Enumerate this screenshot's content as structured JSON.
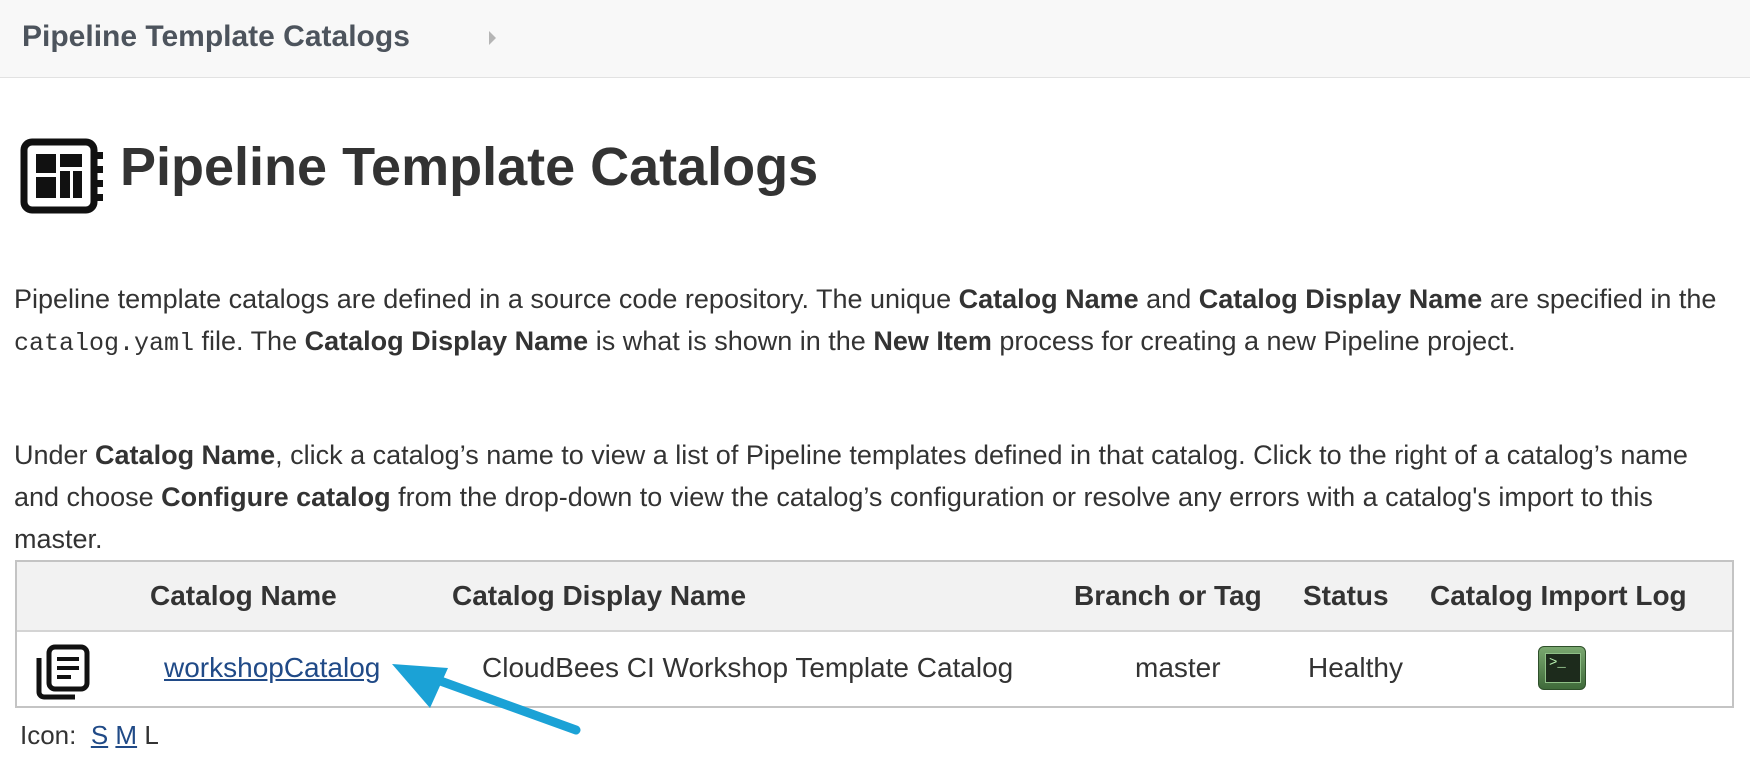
{
  "breadcrumb": {
    "item": "Pipeline Template Catalogs"
  },
  "header": {
    "title": "Pipeline Template Catalogs",
    "icon": "catalog-grid-icon"
  },
  "description": {
    "p1": [
      {
        "text": "Pipeline template catalogs are defined in a source code repository. The unique ",
        "style": "normal"
      },
      {
        "text": "Catalog Name",
        "style": "bold"
      },
      {
        "text": " and ",
        "style": "normal"
      },
      {
        "text": "Catalog Display Name",
        "style": "bold"
      },
      {
        "text": " are specified in the ",
        "style": "normal"
      },
      {
        "text": "catalog.yaml",
        "style": "code"
      },
      {
        "text": " file. The ",
        "style": "normal"
      },
      {
        "text": "Catalog Display Name",
        "style": "bold"
      },
      {
        "text": " is what is shown in the ",
        "style": "normal"
      },
      {
        "text": "New Item",
        "style": "bold"
      },
      {
        "text": " process for creating a new Pipeline project.",
        "style": "normal"
      }
    ],
    "p2": [
      {
        "text": "Under ",
        "style": "normal"
      },
      {
        "text": "Catalog Name",
        "style": "bold"
      },
      {
        "text": ", click a catalog’s name to view a list of Pipeline templates defined in that catalog. Click to the right of a catalog’s name and choose ",
        "style": "normal"
      },
      {
        "text": "Configure catalog",
        "style": "bold"
      },
      {
        "text": " from the drop-down to view the catalog’s configuration or resolve any errors with a catalog's import to this master.",
        "style": "normal"
      }
    ]
  },
  "table": {
    "headers": {
      "name": "Catalog Name",
      "display": "Catalog Display Name",
      "branch": "Branch or Tag",
      "status": "Status",
      "log": "Catalog Import Log"
    },
    "row": {
      "icon": "catalog-document-icon",
      "name": "workshopCatalog",
      "display": "CloudBees CI Workshop Template Catalog",
      "branch": "master",
      "status": "Healthy",
      "log_icon": "terminal-icon"
    }
  },
  "icon_size": {
    "label": "Icon:",
    "small": "S",
    "medium": "M",
    "large": "L"
  },
  "colors": {
    "link": "#204a87",
    "annotation_arrow": "#1ba2d6"
  }
}
